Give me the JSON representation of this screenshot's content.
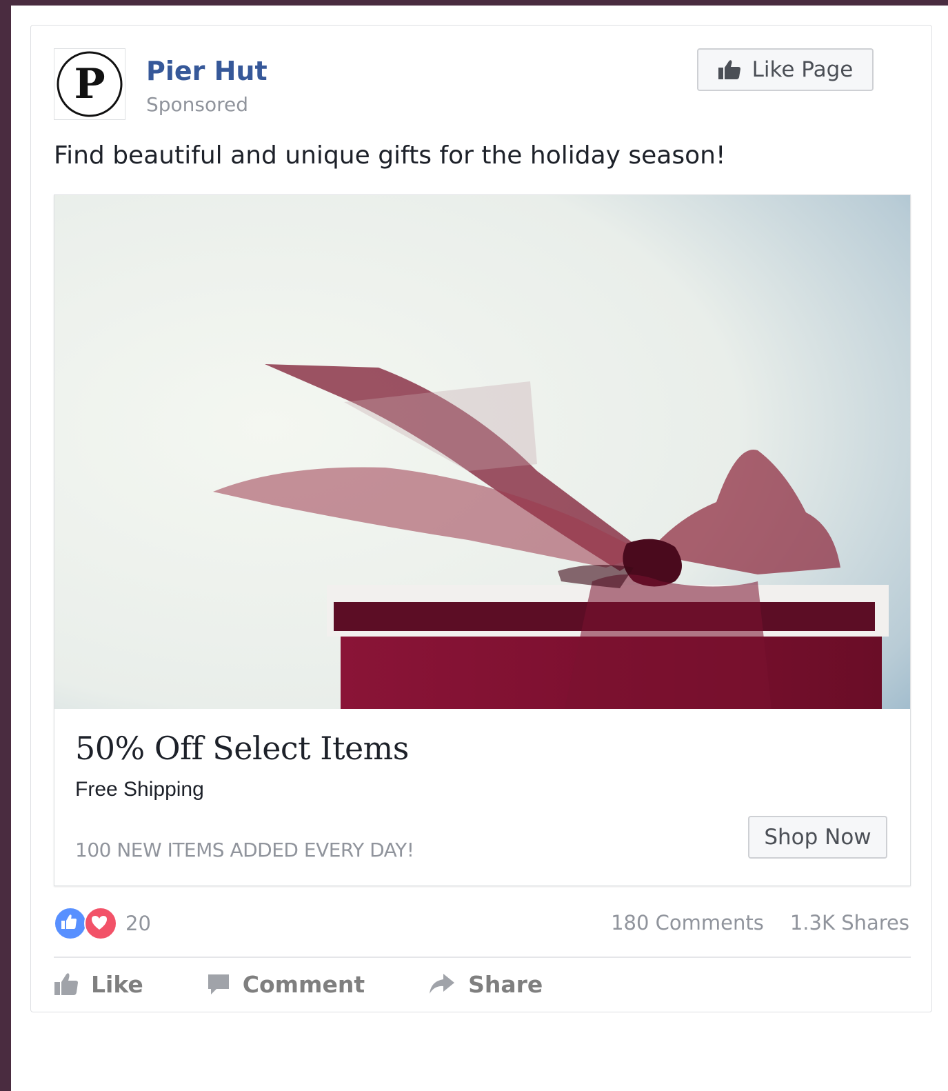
{
  "post": {
    "avatar_letter": "P",
    "page_name": "Pier Hut",
    "sponsored_label": "Sponsored",
    "like_page_label": "Like Page",
    "text": "Find beautiful and unique gifts for the holiday season!"
  },
  "ad": {
    "image_subject": "red-gift-box-with-sheer-ribbon-bow",
    "headline": "50% Off Select Items",
    "subline": "Free Shipping",
    "caption": "100 NEW ITEMS ADDED EVERY DAY!",
    "cta_label": "Shop Now"
  },
  "engagement": {
    "reaction_icons": [
      "like-reaction-icon",
      "love-reaction-icon"
    ],
    "reaction_count": "20",
    "comments": "180 Comments",
    "shares": "1.3K Shares"
  },
  "actions": {
    "like_label": "Like",
    "comment_label": "Comment",
    "share_label": "Share"
  },
  "colors": {
    "link_blue": "#365899",
    "like_blue": "#5890ff",
    "love_red": "#f25268",
    "muted_gray": "#90949c",
    "gift_red": "#7a1230"
  }
}
